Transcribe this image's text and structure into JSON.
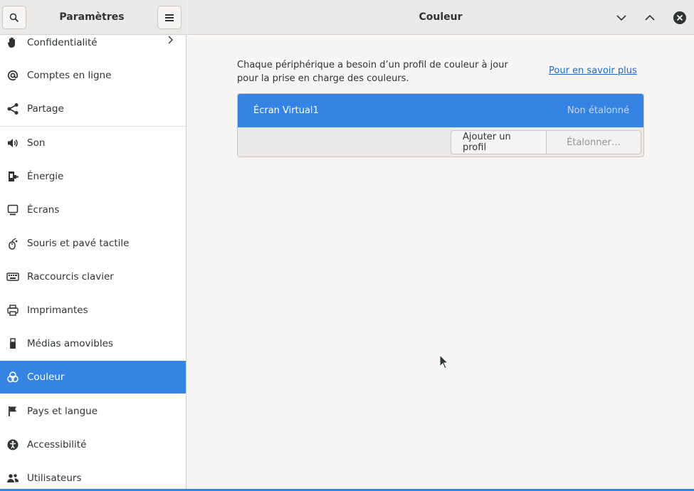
{
  "sidebar": {
    "title": "Paramètres",
    "search_icon": "search-icon",
    "menu_icon": "hamburger-menu-icon",
    "items": [
      {
        "label": "Confidentialité",
        "icon": "hand-icon",
        "has_chevron": true
      },
      {
        "label": "Comptes en ligne",
        "icon": "at-icon"
      },
      {
        "label": "Partage",
        "icon": "share-icon"
      },
      {
        "label": "Son",
        "icon": "speaker-icon"
      },
      {
        "label": "Énergie",
        "icon": "plug-icon"
      },
      {
        "label": "Écrans",
        "icon": "display-icon"
      },
      {
        "label": "Souris et pavé tactile",
        "icon": "mouse-icon"
      },
      {
        "label": "Raccourcis clavier",
        "icon": "keyboard-icon"
      },
      {
        "label": "Imprimantes",
        "icon": "printer-icon"
      },
      {
        "label": "Médias amovibles",
        "icon": "usb-icon"
      },
      {
        "label": "Couleur",
        "icon": "color-icon",
        "active": true
      },
      {
        "label": "Pays et langue",
        "icon": "flag-icon"
      },
      {
        "label": "Accessibilité",
        "icon": "accessibility-icon"
      },
      {
        "label": "Utilisateurs",
        "icon": "users-icon"
      }
    ]
  },
  "header": {
    "title": "Couleur"
  },
  "main": {
    "description": "Chaque périphérique a besoin d’un profil de couleur à jour pour la prise en charge des couleurs.",
    "learn_more": "Pour en savoir plus",
    "device": {
      "name": "Écran Virtual1",
      "status": "Non étalonné"
    },
    "buttons": {
      "add_profile": "Ajouter un profil",
      "calibrate": "Étalonner…"
    }
  },
  "colors": {
    "accent": "#3584e4",
    "link": "#1b6acb"
  }
}
